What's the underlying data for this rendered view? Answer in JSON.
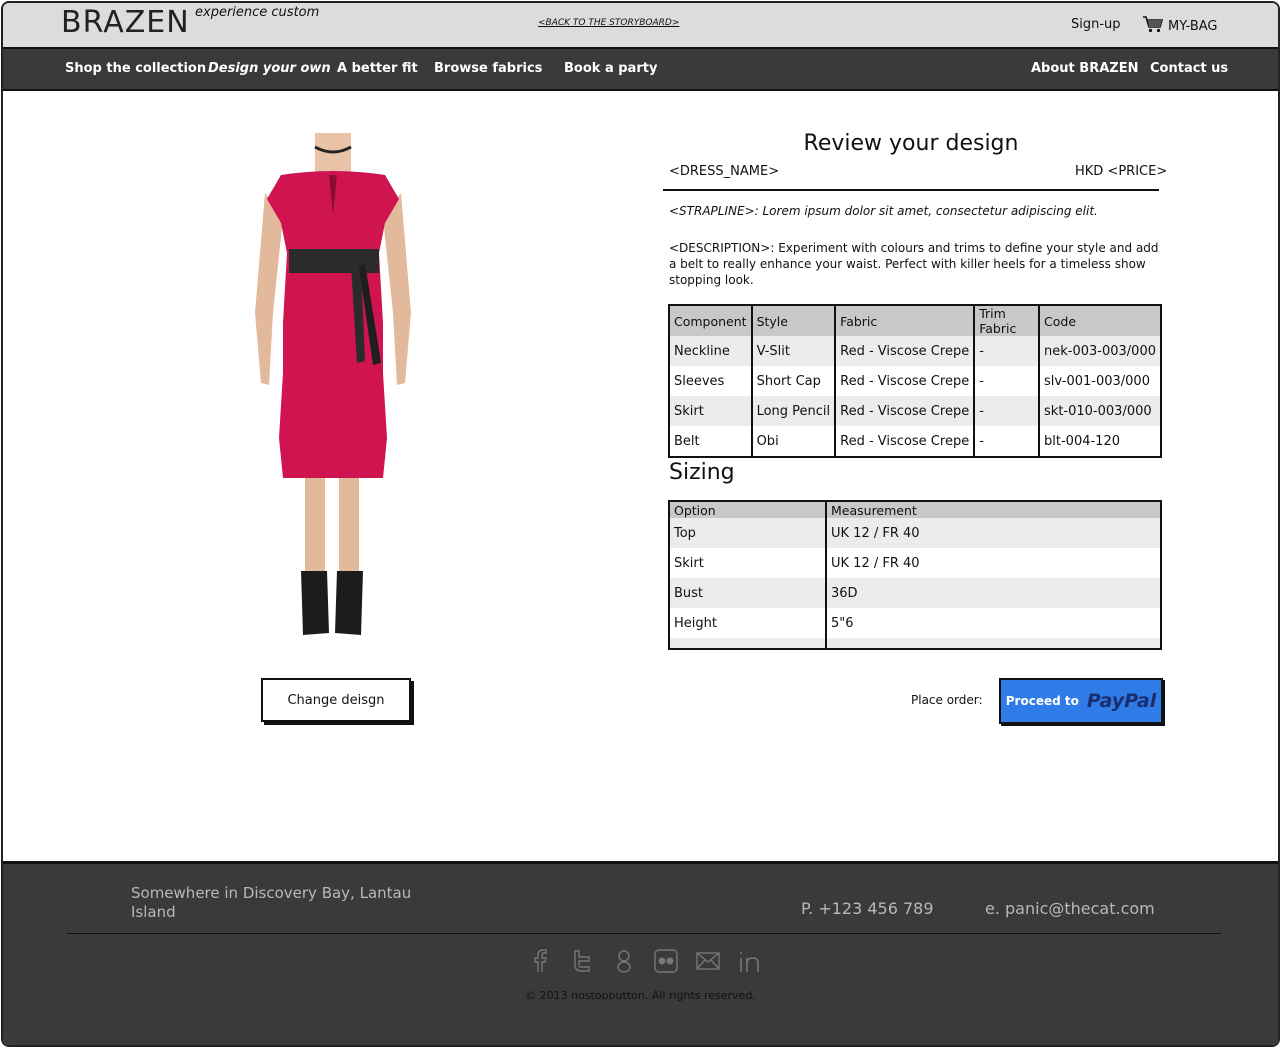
{
  "header": {
    "logo": "BRAZEN",
    "tagline": "experience custom",
    "back_link": "<BACK TO THE STORYBOARD>",
    "signup": "Sign-up",
    "bag": "MY-BAG"
  },
  "nav": {
    "items": [
      {
        "label": "Shop the collection"
      },
      {
        "label": "Design your own"
      },
      {
        "label": "A better fit"
      },
      {
        "label": "Browse fabrics"
      },
      {
        "label": "Book a party"
      },
      {
        "label": "About BRAZEN"
      },
      {
        "label": "Contact us"
      }
    ]
  },
  "left": {
    "change_button": "Change deisgn"
  },
  "review": {
    "title": "Review your design",
    "dress_name": "<DRESS_NAME>",
    "price": "HKD <PRICE>",
    "strapline": "<STRAPLINE>: Lorem ipsum dolor sit amet, consectetur adipiscing elit.",
    "description": "<DESCRIPTION>: Experiment with colours and trims to define your style and add a belt to really enhance your waist. Perfect with killer heels for a timeless show stopping look."
  },
  "components_table": {
    "headers": [
      "Component",
      "Style",
      "Fabric",
      "Trim Fabric",
      "Code"
    ],
    "rows": [
      [
        "Neckline",
        "V-Slit",
        "Red - Viscose Crepe",
        "-",
        "nek-003-003/000"
      ],
      [
        "Sleeves",
        "Short Cap",
        "Red - Viscose Crepe",
        "-",
        "slv-001-003/000"
      ],
      [
        "Skirt",
        "Long Pencil",
        "Red - Viscose Crepe",
        "-",
        "skt-010-003/000"
      ],
      [
        "Belt",
        "Obi",
        "Red - Viscose Crepe",
        "-",
        "blt-004-120"
      ]
    ]
  },
  "sizing": {
    "title": "Sizing",
    "headers": [
      "Option",
      "Measurement"
    ],
    "rows": [
      [
        "Top",
        "UK 12 / FR 40"
      ],
      [
        "Skirt",
        "UK 12 / FR 40"
      ],
      [
        "Bust",
        "36D"
      ],
      [
        "Height",
        "5\"6"
      ]
    ]
  },
  "order": {
    "place_label": "Place order:",
    "paypal_prefix": "Proceed to",
    "paypal_brand": "PayPal",
    "paypal_color": "#2f7be8"
  },
  "footer": {
    "address": "Somewhere in Discovery Bay, Lantau Island",
    "phone": "P. +123 456 789",
    "email": "e. panic@thecat.com",
    "social_icons": [
      "facebook-icon",
      "twitter-icon",
      "google-plus-icon",
      "flickr-icon",
      "mail-icon",
      "linkedin-icon"
    ],
    "copyright": "© 2013 nostopbutton. All rights reserved."
  },
  "colors": {
    "dress": "#d0144f",
    "nav_bg": "#3a3a3a",
    "header_bg": "#dcdcdc"
  }
}
